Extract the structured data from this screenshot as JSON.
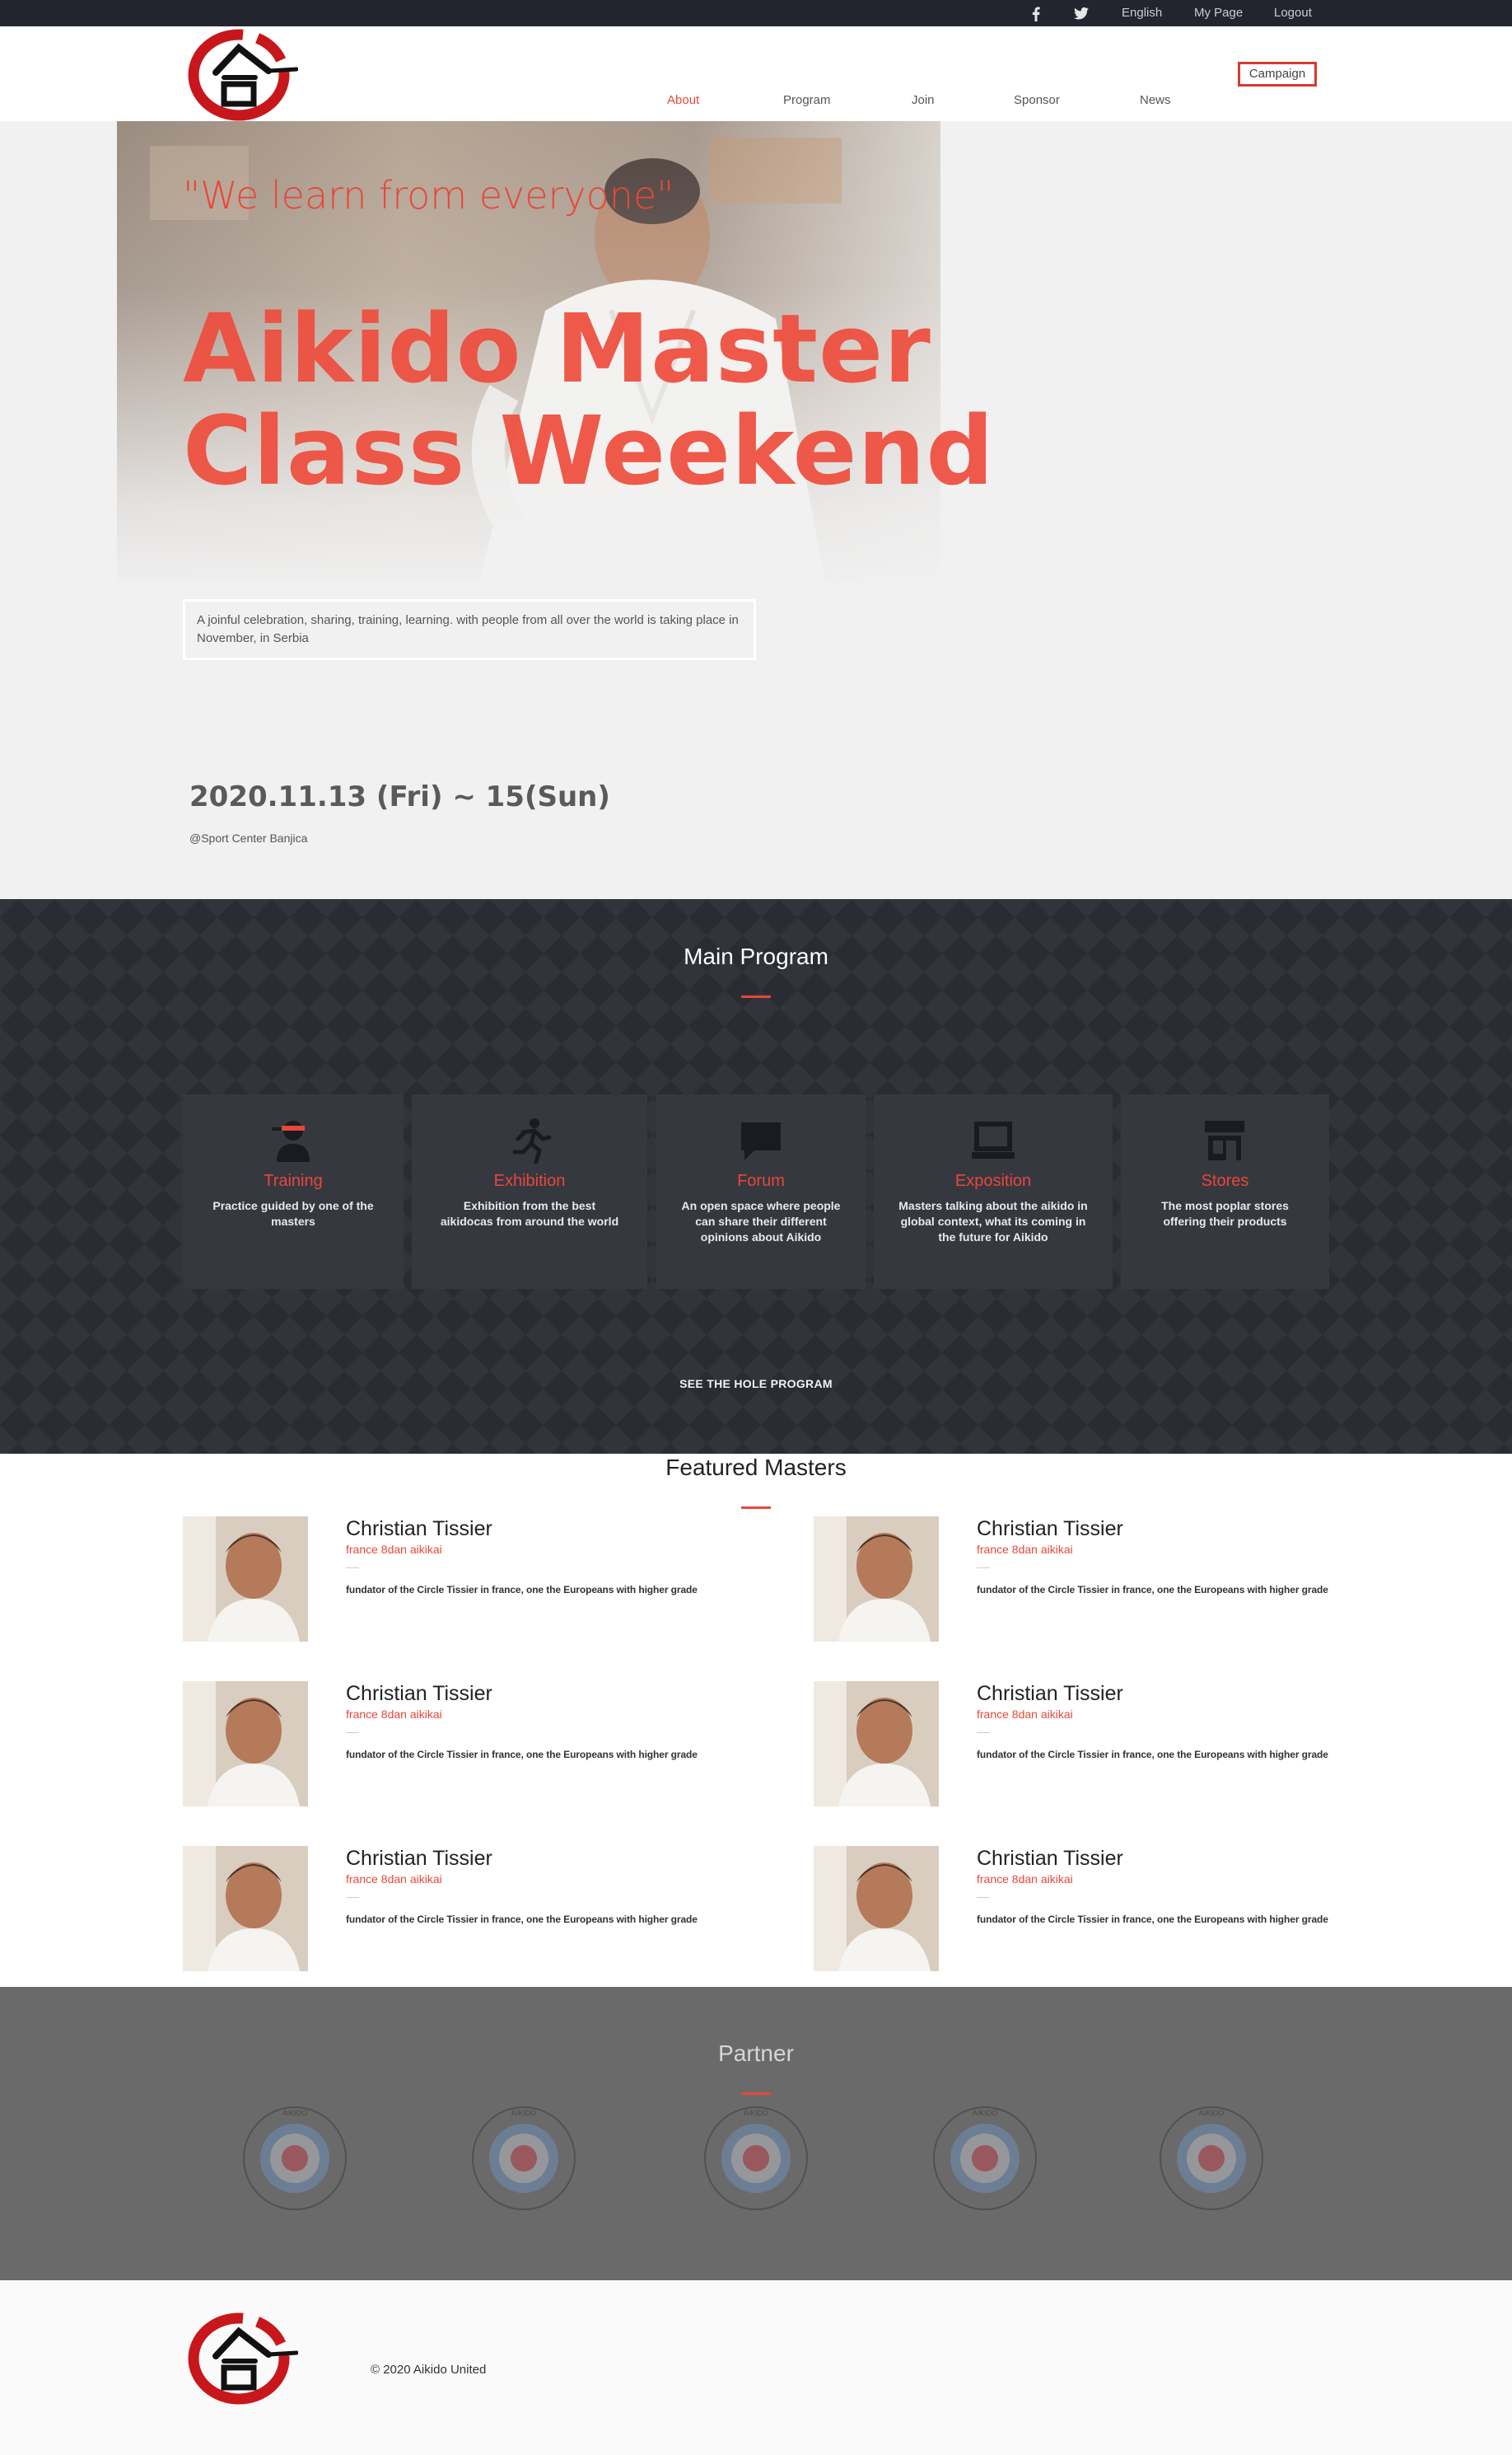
{
  "topbar": {
    "icons": [
      "facebook-icon",
      "twitter-icon"
    ],
    "links": [
      "English",
      "My Page",
      "Logout"
    ]
  },
  "nav": {
    "items": [
      "About",
      "Program",
      "Join",
      "Sponsor",
      "News"
    ],
    "active": "About",
    "campaign": "Campaign"
  },
  "hero": {
    "quote": "\"We learn from everyone\"",
    "title_line1": "Aikido Master",
    "title_line2": "Class Weekend",
    "description": "A joinful celebration, sharing, training, learning. with people from all over the world is taking place in November, in Serbia",
    "date": "2020.11.13 (Fri) ~ 15(Sun)",
    "venue": "@Sport Center Banjica"
  },
  "program": {
    "title": "Main Program",
    "cards": [
      {
        "icon": "trainer-icon",
        "title": "Training",
        "text": "Practice guided by one of the masters"
      },
      {
        "icon": "running-person-icon",
        "title": "Exhibition",
        "text": "Exhibition from the best aikidocas from around the world"
      },
      {
        "icon": "chat-bubble-icon",
        "title": "Forum",
        "text": "An open space where people can share their different opinions about Aikido"
      },
      {
        "icon": "laptop-icon",
        "title": "Exposition",
        "text": "Masters talking about the aikido in global context, what its coming in the future for Aikido"
      },
      {
        "icon": "store-icon",
        "title": "Stores",
        "text": "The most poplar stores offering their products"
      }
    ],
    "button": "SEE THE HOLE PROGRAM"
  },
  "masters": {
    "title": "Featured Masters",
    "items": [
      {
        "name": "Christian Tissier",
        "grade": "france 8dan aikikai",
        "bio": "fundator of the Circle Tissier in france, one the Europeans with higher grade"
      },
      {
        "name": "Christian Tissier",
        "grade": "france 8dan aikikai",
        "bio": "fundator of the Circle Tissier in france, one the Europeans with higher grade"
      },
      {
        "name": "Christian Tissier",
        "grade": "france 8dan aikikai",
        "bio": "fundator of the Circle Tissier in france, one the Europeans with higher grade"
      },
      {
        "name": "Christian Tissier",
        "grade": "france 8dan aikikai",
        "bio": "fundator of the Circle Tissier in france, one the Europeans with higher grade"
      },
      {
        "name": "Christian Tissier",
        "grade": "france 8dan aikikai",
        "bio": "fundator of the Circle Tissier in france, one the Europeans with higher grade"
      },
      {
        "name": "Christian Tissier",
        "grade": "france 8dan aikikai",
        "bio": "fundator of the Circle Tissier in france, one the Europeans with higher grade"
      }
    ]
  },
  "partners": {
    "title": "Partner",
    "logo_text": "AIKIDO FEDERATION INTERNATIONAL",
    "count": 5
  },
  "footer": {
    "copyright": "© 2020 Aikido United"
  },
  "colors": {
    "accent": "#e8473a",
    "dark": "#23252e",
    "program_bg": "#2a2c34",
    "partner_bg": "#6a6a6a"
  }
}
